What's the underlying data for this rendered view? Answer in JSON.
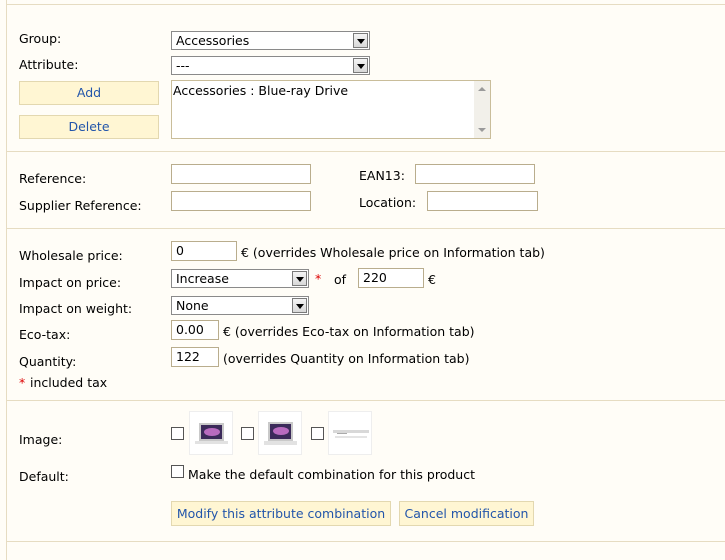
{
  "group": {
    "label": "Group:",
    "value": "Accessories"
  },
  "attribute": {
    "label": "Attribute:",
    "value": "---"
  },
  "buttons": {
    "add": "Add",
    "delete": "Delete"
  },
  "attribute_list": {
    "items": [
      "Accessories : Blue-ray Drive"
    ]
  },
  "reference": {
    "label": "Reference:",
    "value": ""
  },
  "ean13": {
    "label": "EAN13:",
    "value": ""
  },
  "supplier_reference": {
    "label": "Supplier Reference:",
    "value": ""
  },
  "location": {
    "label": "Location:",
    "value": ""
  },
  "wholesale_price": {
    "label": "Wholesale price:",
    "value": "0",
    "note": "€ (overrides Wholesale price on Information tab)"
  },
  "impact_price": {
    "label": "Impact on price:",
    "value": "Increase",
    "asterisk": "*",
    "of": "of",
    "amount": "220",
    "currency": "€"
  },
  "impact_weight": {
    "label": "Impact on weight:",
    "value": "None"
  },
  "eco_tax": {
    "label": "Eco-tax:",
    "value": "0.00",
    "note": "€ (overrides Eco-tax on Information tab)"
  },
  "quantity": {
    "label": "Quantity:",
    "value": "122",
    "note": "(overrides Quantity on Information tab)"
  },
  "included_tax": {
    "asterisk": "*",
    "text": "included tax"
  },
  "image": {
    "label": "Image:"
  },
  "default": {
    "label": "Default:",
    "checkbox_label": "Make the default combination for this product"
  },
  "actions": {
    "modify": "Modify this attribute combination",
    "cancel": "Cancel modification"
  },
  "colors": {
    "button_bg": "#fff6d3",
    "button_text": "#2255aa",
    "divider": "#e6dcc2",
    "asterisk": "#dd0000"
  }
}
